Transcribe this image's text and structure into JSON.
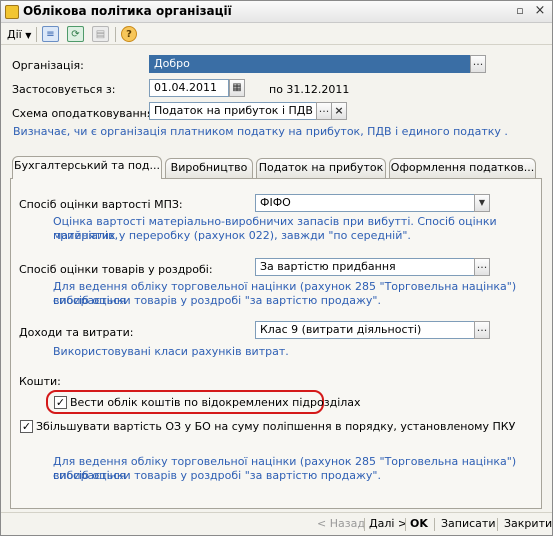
{
  "window": {
    "title": "Облікова політика організації"
  },
  "toolbar": {
    "actions_label": "Дії"
  },
  "form": {
    "organization": {
      "label": "Організація:",
      "value": "Добро"
    },
    "applies_from": {
      "label": "Застосовується з:",
      "value": "01.04.2011",
      "until": "по 31.12.2011"
    },
    "tax_scheme": {
      "label": "Схема оподатковування:",
      "value": "Податок на прибуток і ПДВ"
    },
    "tax_hint": "Визначає, чи є організація платником податку на прибуток, ПДВ і единого податку ."
  },
  "tabs": [
    {
      "label": "Бухгалтерський та под..."
    },
    {
      "label": "Виробництво"
    },
    {
      "label": "Податок на прибуток"
    },
    {
      "label": "Оформлення податков..."
    }
  ],
  "accounting": {
    "mpz": {
      "label": "Спосіб оцінки вартості МПЗ:",
      "value": "ФІФО",
      "hint1": "Оцінка вартості матеріально-виробничих запасів при вибутті. Спосіб оцінки матеріалів,",
      "hint2": "прийнятих у переробку (рахунок 022), завжди \"по середній\"."
    },
    "retail": {
      "label": "Спосіб оцінки товарів у роздробі:",
      "value": "За вартістю придбання",
      "hint1": "Для ведення обліку торговельної націнки (рахунок 285 \"Торговельна націнка\") вибирається",
      "hint2": "спосіб оцінки товарів у роздробі \"за вартістю продажу\"."
    },
    "income": {
      "label": "Доходи та витрати:",
      "value": "Клас 9 (витрати діяльності)",
      "hint": "Використовувані класи рахунків витрат."
    },
    "funds_label": "Кошти:",
    "check_divisions": {
      "label": "Вести облік коштів по відокремлених підрозділах",
      "checked": true
    },
    "check_increase": {
      "label": "Збільшувати вартість ОЗ у БО на суму поліпшення в порядку, установленому ПКУ",
      "checked": true
    },
    "bottom_hint1": "Для ведення обліку торговельної націнки (рахунок 285 \"Торговельна націнка\") вибирається",
    "bottom_hint2": "спосіб оцінки товарів у роздробі \"за вартістю продажу\"."
  },
  "footer": {
    "back": "< Назад",
    "next": "Далі >",
    "ok": "OK",
    "save": "Записати",
    "close": "Закрити"
  },
  "colors": {
    "hint": "#2e5fb4",
    "selection": "#3a6ea5",
    "highlight": "#d41919"
  }
}
